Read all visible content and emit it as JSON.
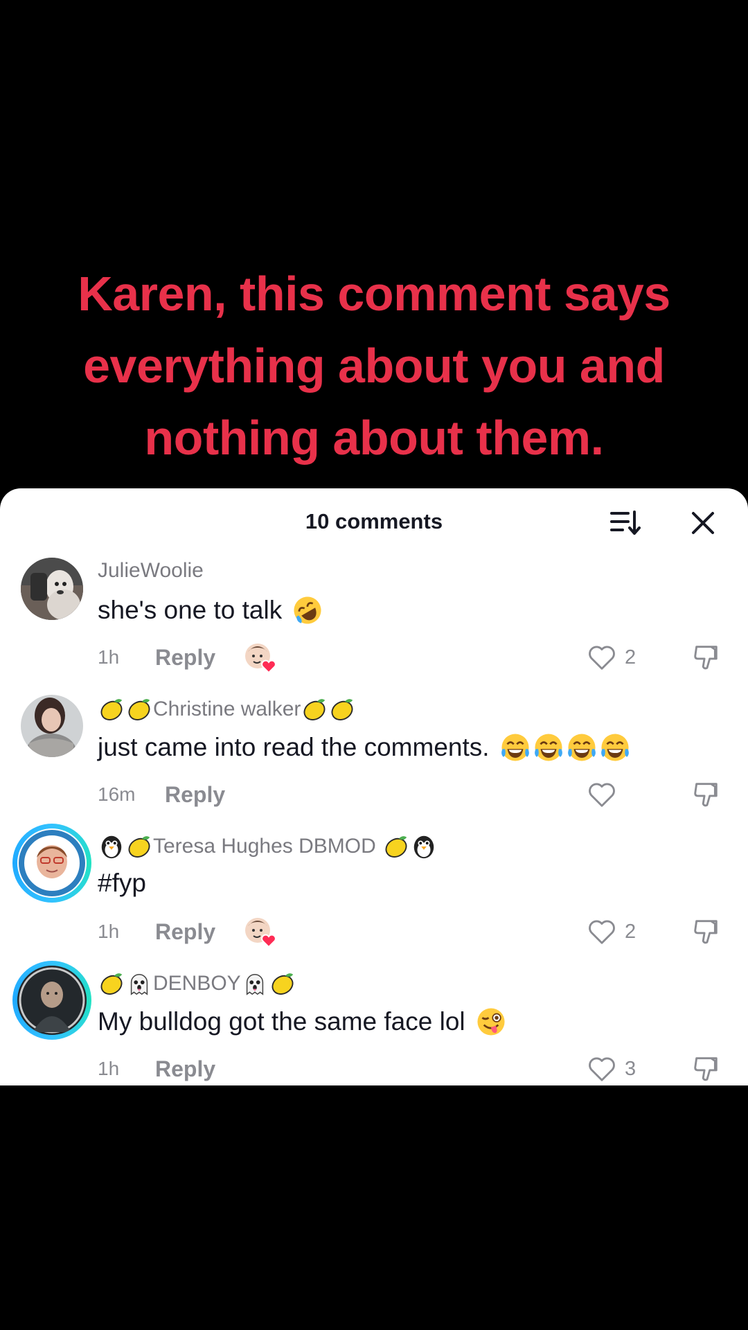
{
  "video": {
    "caption": [
      "Karen, this comment says",
      "everything about you and",
      "nothing about them."
    ]
  },
  "sheet": {
    "title": "10 comments",
    "sort_icon": "sort-icon",
    "close_icon": "close-icon"
  },
  "comments": [
    {
      "username": "JulieWoolie",
      "text": "she's one to talk",
      "text_emoji": [
        "rolling-laugh"
      ],
      "time": "1h",
      "reply_label": "Reply",
      "creator_liked": true,
      "likes": "2"
    },
    {
      "username": "Christine walker",
      "username_prefix": [
        "lemon",
        "lemon"
      ],
      "username_suffix": [
        "lemon",
        "lemon"
      ],
      "text": "just came into read the comments.",
      "text_emoji": [
        "tears-of-joy",
        "tears-of-joy",
        "tears-of-joy",
        "tears-of-joy"
      ],
      "time": "16m",
      "reply_label": "Reply",
      "creator_liked": false,
      "likes": ""
    },
    {
      "username": "Teresa Hughes DBMOD",
      "username_prefix": [
        "penguin",
        "lemon"
      ],
      "username_suffix": [
        "lemon",
        "penguin"
      ],
      "text": "#fyp",
      "time": "1h",
      "reply_label": "Reply",
      "creator_liked": true,
      "likes": "2"
    },
    {
      "username": "DENBOY",
      "username_prefix": [
        "lemon",
        "ghost"
      ],
      "username_suffix": [
        "ghost",
        "lemon"
      ],
      "text": "My bulldog got the same face lol",
      "text_emoji": [
        "winking-tongue"
      ],
      "time": "1h",
      "reply_label": "Reply",
      "creator_liked": false,
      "likes": "3"
    }
  ],
  "colors": {
    "caption": "#e8314a",
    "sheet_bg": "#ffffff",
    "muted_text": "#8a8b91",
    "primary_text": "#161823",
    "creator_heart": "#fe2c55"
  }
}
